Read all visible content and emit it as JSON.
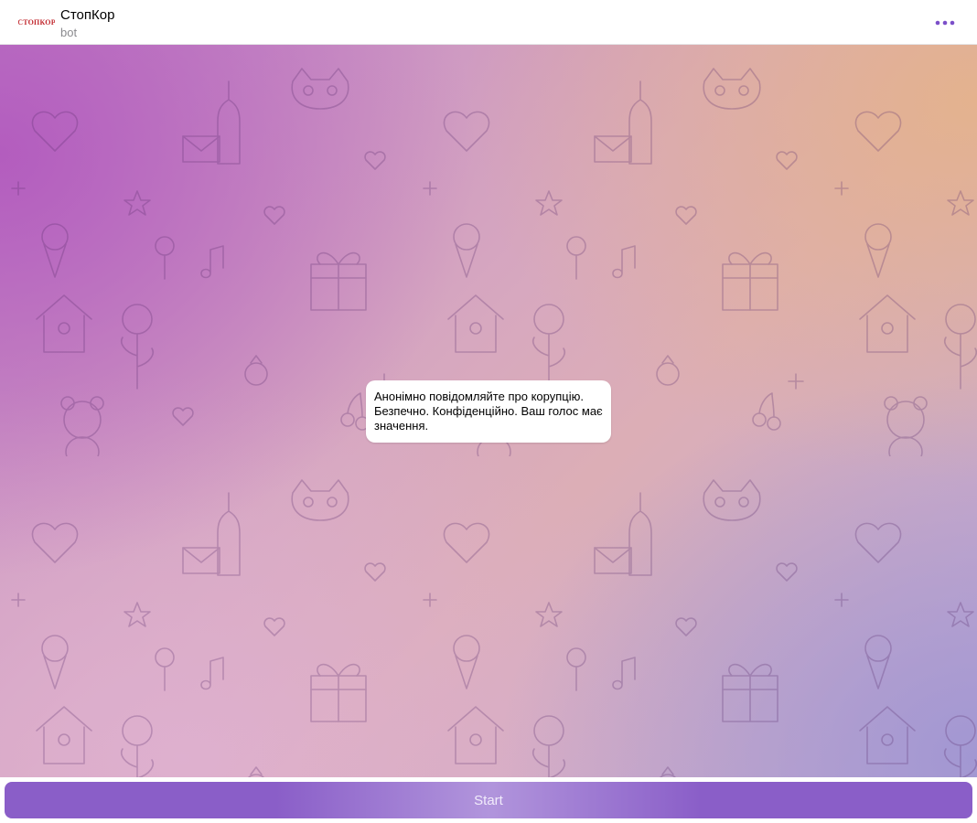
{
  "header": {
    "title": "СтопКор",
    "subtitle": "bot",
    "avatar_text": "СТОПКОР",
    "menu_icon": "more-dots-icon"
  },
  "chat": {
    "messages": [
      {
        "text": "Анонімно повідомляйте про корупцію. Безпечно. Конфіденційно. Ваш голос має значення."
      }
    ],
    "wallpaper": "love-doodles-pattern"
  },
  "bottom": {
    "start_label": "Start"
  },
  "colors": {
    "accent": "#8a5ec8",
    "menu_dots": "#7b4fc9",
    "logo_red": "#c1272d"
  }
}
